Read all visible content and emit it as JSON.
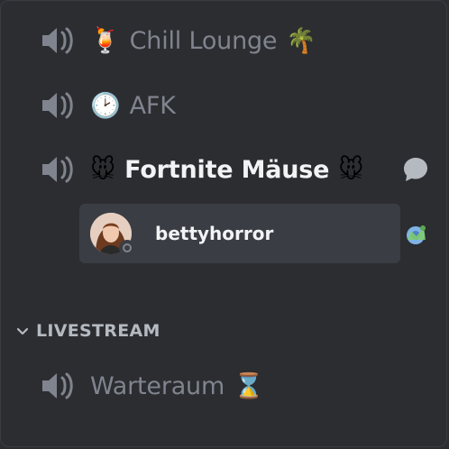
{
  "channels": [
    {
      "emoji": "🍹",
      "label": "Chill Lounge",
      "tail": "🌴"
    },
    {
      "emoji": "🕑",
      "label": "AFK",
      "tail": ""
    },
    {
      "emoji": "🐭",
      "label": "Fortnite Mäuse",
      "tail": "🐭"
    }
  ],
  "connected_user": {
    "name": "bettyhorror",
    "status": "offline"
  },
  "category": {
    "label": "LIVESTREAM"
  },
  "category_channels": [
    {
      "label": "Warteraum",
      "tail": "⌛"
    }
  ],
  "colors": {
    "background": "#2b2d31",
    "muted_text": "#80848e",
    "active_text": "#f2f3f5",
    "row_highlight": "#3b3d44"
  }
}
